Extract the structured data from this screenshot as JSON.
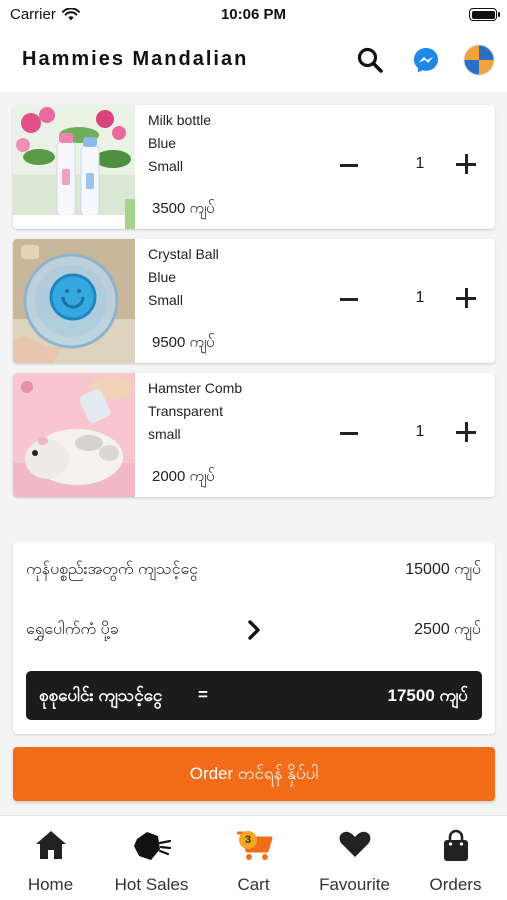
{
  "status_bar": {
    "carrier": "Carrier",
    "time": "10:06 PM"
  },
  "header": {
    "title": "Hammies  Mandalian",
    "icons": [
      "search-icon",
      "messenger-icon",
      "profile-icon"
    ]
  },
  "cart": {
    "items": [
      {
        "name": "Milk bottle",
        "color": "Blue",
        "size": "Small",
        "price": "3500 ကျပ်",
        "quantity": "1"
      },
      {
        "name": "Crystal Ball",
        "color": "Blue",
        "size": "Small",
        "price": "9500 ကျပ်",
        "quantity": "1"
      },
      {
        "name": "Hamster Comb",
        "color": "Transparent",
        "size": "small",
        "price": "2000 ကျပ်",
        "quantity": "1"
      }
    ]
  },
  "summary": {
    "subtotal_label": "ကုန်ပစ္စည်းအတွက် ကျသင့်ငွေ",
    "subtotal_value": "15000 ကျပ်",
    "delivery_label": "ရွှေပေါက်ကံ ပို့ခ",
    "delivery_value": "2500 ကျပ်",
    "total_label": "စုစုပေါင်း ကျသင့်ငွေ",
    "total_equals": "=",
    "total_value": "17500 ကျပ်"
  },
  "order_button": {
    "label": "Order တင်ရန် နှိပ်ပါ",
    "color": "#f26c1a"
  },
  "bottom_nav": {
    "items": [
      {
        "label": "Home",
        "icon": "home-icon"
      },
      {
        "label": "Hot Sales",
        "icon": "hot-sales-icon"
      },
      {
        "label": "Cart",
        "icon": "cart-icon",
        "badge": "3"
      },
      {
        "label": "Favourite",
        "icon": "heart-icon"
      },
      {
        "label": "Orders",
        "icon": "shopping-bag-icon"
      }
    ]
  },
  "colors": {
    "accent": "#f26c1a",
    "total_bar": "#1c1c1c",
    "badge": "#f5a623"
  }
}
